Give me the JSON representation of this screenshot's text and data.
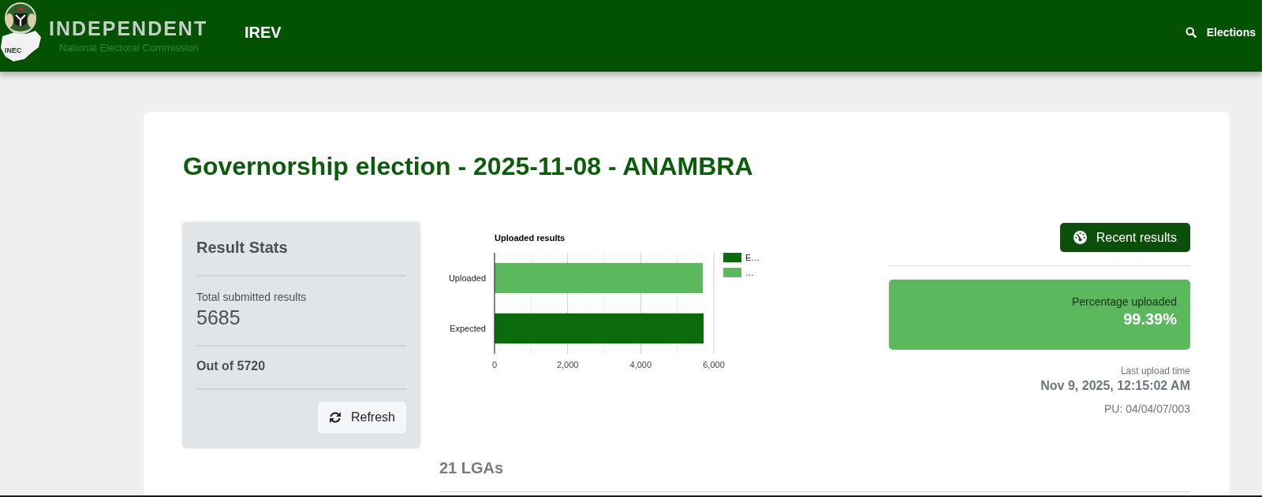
{
  "header": {
    "logo_text": "INEC",
    "brand_title": "INDEPENDENT",
    "brand_subtitle": "National Electoral Commission",
    "app_name": "IREV",
    "nav_link": {
      "label": "Elections"
    }
  },
  "page_title": "Governorship election - 2025-11-08 - ANAMBRA",
  "result_stats": {
    "title": "Result Stats",
    "total_label": "Total submitted results",
    "total_value": "5685",
    "out_of": "Out of 5720",
    "refresh_button": "Refresh"
  },
  "upload_chart": {
    "chart_data": {
      "type": "bar",
      "orientation": "horizontal",
      "stacked": true,
      "title": "Uploaded results",
      "categories": [
        "Uploaded",
        "Expected"
      ],
      "series": [
        {
          "name": "E…",
          "color": "#0b6b0b",
          "values": [
            null,
            5720
          ]
        },
        {
          "name": "…",
          "color": "#5cb85c",
          "values": [
            5700,
            null
          ]
        }
      ],
      "xlim": [
        0,
        6000
      ],
      "xticks": [
        0,
        {
          "value": 2000,
          "label": "2,000"
        },
        {
          "value": 4000,
          "label": "4,000"
        },
        {
          "value": 6000,
          "label": "6,000"
        }
      ],
      "legend": "right"
    }
  },
  "recent_results_button": "Recent results",
  "percentage_panel": {
    "label": "Percentage uploaded",
    "value": "99.39%"
  },
  "last_upload": {
    "label": "Last upload time",
    "time": "Nov 9, 2025, 12:15:02 AM",
    "polling_unit": "PU: 04/04/07/003"
  },
  "lga_section": {
    "heading": "21 LGAs"
  }
}
